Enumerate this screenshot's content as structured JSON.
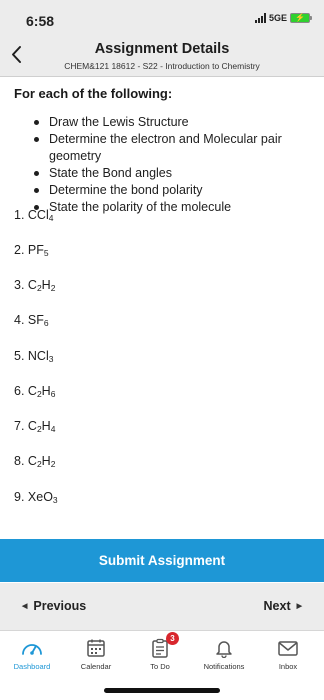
{
  "status_bar": {
    "time": "6:58",
    "network": "5GE"
  },
  "header": {
    "title": "Assignment Details",
    "subtitle": "CHEM&121 18612 - S22 - Introduction to Chemistry"
  },
  "content": {
    "heading": "For each of the following:",
    "bullets": [
      "Draw the Lewis Structure",
      "Determine the electron and Molecular pair geometry",
      "State the Bond angles",
      "Determine the bond polarity",
      "State the polarity of the molecule"
    ],
    "questions": [
      {
        "num": "1.",
        "parts": [
          {
            "t": "CCl"
          },
          {
            "s": "4"
          }
        ]
      },
      {
        "num": "2.",
        "parts": [
          {
            "t": "PF"
          },
          {
            "s": "5"
          }
        ]
      },
      {
        "num": "3.",
        "parts": [
          {
            "t": "C"
          },
          {
            "s": "2"
          },
          {
            "t": "H"
          },
          {
            "s": "2"
          }
        ]
      },
      {
        "num": "4.",
        "parts": [
          {
            "t": "SF"
          },
          {
            "s": "6"
          }
        ]
      },
      {
        "num": "5.",
        "parts": [
          {
            "t": "NCl"
          },
          {
            "s": "3"
          }
        ]
      },
      {
        "num": "6.",
        "parts": [
          {
            "t": "C"
          },
          {
            "s": "2"
          },
          {
            "t": "H"
          },
          {
            "s": "6"
          }
        ]
      },
      {
        "num": "7.",
        "parts": [
          {
            "t": "C"
          },
          {
            "s": "2"
          },
          {
            "t": "H"
          },
          {
            "s": "4"
          }
        ]
      },
      {
        "num": "8.",
        "parts": [
          {
            "t": "C"
          },
          {
            "s": "2"
          },
          {
            "t": "H"
          },
          {
            "s": "2"
          }
        ]
      },
      {
        "num": "9.",
        "parts": [
          {
            "t": "XeO"
          },
          {
            "s": "3"
          }
        ]
      }
    ]
  },
  "submit_label": "Submit Assignment",
  "pager": {
    "previous": "Previous",
    "next": "Next"
  },
  "tabs": [
    {
      "label": "Dashboard",
      "icon": "dashboard-icon",
      "active": true
    },
    {
      "label": "Calendar",
      "icon": "calendar-icon"
    },
    {
      "label": "To Do",
      "icon": "todo-icon",
      "badge": "3"
    },
    {
      "label": "Notifications",
      "icon": "bell-icon"
    },
    {
      "label": "Inbox",
      "icon": "inbox-icon"
    }
  ],
  "colors": {
    "accent": "#1e97d6",
    "badge": "#d8262d",
    "battery": "#2fd12f"
  }
}
